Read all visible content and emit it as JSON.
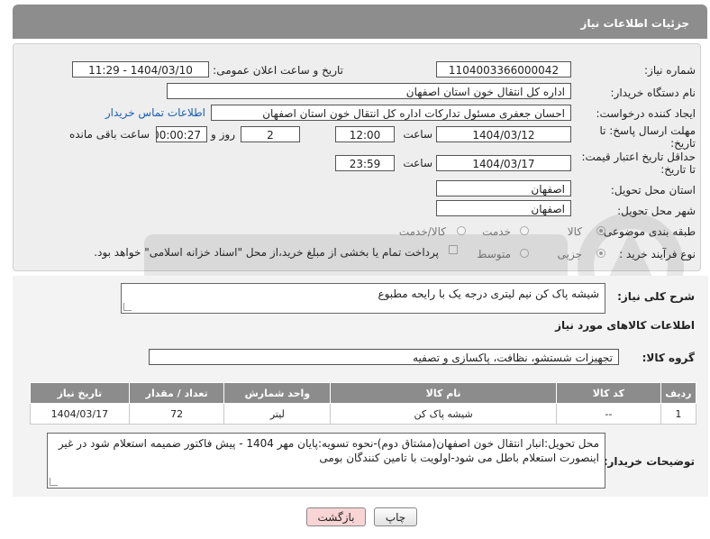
{
  "header": {
    "title": "جزئیات اطلاعات نیاز"
  },
  "form": {
    "need_number": {
      "label": "شماره نیاز:",
      "value": "1104003366000042"
    },
    "announce_datetime": {
      "label": "تاریخ و ساعت اعلان عمومی:",
      "value": "1404/03/10 - 11:29"
    },
    "buyer_org": {
      "label": "نام دستگاه خریدار:",
      "value": "اداره کل انتقال خون استان اصفهان"
    },
    "creator": {
      "label": "ایجاد کننده درخواست:",
      "value": "احسان جعفری مسئول تدارکات اداره کل انتقال خون استان اصفهان",
      "contact_link": "اطلاعات تماس خریدار"
    },
    "reply_deadline": {
      "label_line1": "مهلت ارسال پاسخ: تا",
      "label_line2": "تاریخ:",
      "date": "1404/03/12",
      "time_label": "ساعت",
      "time": "12:00",
      "days": "2",
      "days_label": "روز و",
      "remaining": "00:00:27",
      "remaining_label": "ساعت باقی مانده"
    },
    "price_validity": {
      "label_line1": "حداقل تاریخ اعتبار قیمت:",
      "label_line2": "تا تاریخ:",
      "date": "1404/03/17",
      "time_label": "ساعت",
      "time": "23:59"
    },
    "delivery_province": {
      "label": "استان محل تحویل:",
      "value": "اصفهان"
    },
    "delivery_city": {
      "label": "شهر محل تحویل:",
      "value": "اصفهان"
    },
    "subject_class": {
      "label": "طبقه بندی موضوعی:",
      "options": [
        "کالا",
        "خدمت",
        "کالا/خدمت"
      ],
      "selected": "کالا"
    },
    "purchase_type": {
      "label": "نوع فرآیند خرید :",
      "options": [
        "جزیی",
        "متوسط"
      ],
      "selected": "جزیی",
      "payment_note": "پرداخت تمام یا بخشی از مبلغ خرید،از محل \"اسناد خزانه اسلامی\" خواهد بود."
    }
  },
  "description": {
    "label": "شرح کلی نیاز:",
    "value": "شیشه پاک کن نیم لیتری درجه یک با رایحه مطبوع"
  },
  "goods_section": {
    "title": "اطلاعات کالاهای مورد نیاز",
    "group_label": "گروه کالا:",
    "group_value": "تجهیزات شستشو، نظافت، پاکسازی و تصفیه",
    "table": {
      "headers": [
        "ردیف",
        "کد کالا",
        "نام کالا",
        "واحد شمارش",
        "تعداد / مقدار",
        "تاریخ نیاز"
      ],
      "rows": [
        [
          "1",
          "--",
          "شیشه پاک کن",
          "لیتر",
          "72",
          "1404/03/17"
        ]
      ]
    }
  },
  "buyer_notes": {
    "label": "توضیحات خریدار:",
    "value": "محل تحویل:انبار انتقال خون اصفهان(مشتاق دوم)-نحوه تسویه:پایان مهر 1404 - پیش فاکتور ضمیمه استعلام شود در غیر اینصورت استعلام باطل می شود-اولویت با تامین کنندگان بومی"
  },
  "buttons": {
    "print": "چاپ",
    "back": "بازگشت"
  },
  "colors": {
    "header_bg": "#8d8d8d",
    "link": "#1a5fb4",
    "back_button_bg": "#f9d4d4"
  }
}
